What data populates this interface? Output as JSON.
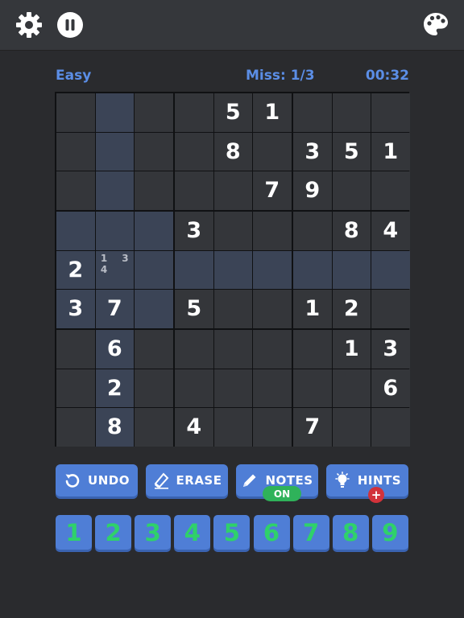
{
  "header": {
    "settings_icon": "gear-icon",
    "pause_icon": "pause-icon",
    "theme_icon": "palette-icon"
  },
  "status": {
    "difficulty": "Easy",
    "misses": "Miss: 1/3",
    "timer": "00:32"
  },
  "colors": {
    "accent": "#4f7ed6",
    "highlight": "#3b4456",
    "cell": "#34363a",
    "numpad_digit": "#2fd16a",
    "notes_on": "#2fb25a",
    "hint_badge": "#d2323a"
  },
  "board": {
    "selected_cell": [
      4,
      1
    ],
    "givens": [
      [
        "",
        "",
        "",
        "",
        "5",
        "1",
        "",
        "",
        ""
      ],
      [
        "",
        "",
        "",
        "",
        "8",
        "",
        "3",
        "5",
        "1"
      ],
      [
        "",
        "",
        "",
        "",
        "",
        "7",
        "9",
        "",
        ""
      ],
      [
        "",
        "",
        "",
        "3",
        "",
        "",
        "",
        "8",
        "4"
      ],
      [
        "2",
        "",
        "",
        "",
        "",
        "",
        "",
        "",
        ""
      ],
      [
        "3",
        "7",
        "",
        "5",
        "",
        "",
        "1",
        "2",
        ""
      ],
      [
        "",
        "6",
        "",
        "",
        "",
        "",
        "",
        "1",
        "3"
      ],
      [
        "",
        "2",
        "",
        "",
        "",
        "",
        "",
        "",
        "6"
      ],
      [
        "",
        "8",
        "",
        "4",
        "",
        "",
        "7",
        "",
        ""
      ]
    ],
    "notes": {
      "4-1": [
        "1",
        "",
        "3",
        "4",
        "",
        "",
        "",
        "",
        ""
      ]
    }
  },
  "tools": {
    "undo_label": "UNDO",
    "erase_label": "ERASE",
    "notes_label": "NOTES",
    "notes_state": "ON",
    "hints_label": "HINTS",
    "hints_badge": "+"
  },
  "numpad": [
    "1",
    "2",
    "3",
    "4",
    "5",
    "6",
    "7",
    "8",
    "9"
  ]
}
